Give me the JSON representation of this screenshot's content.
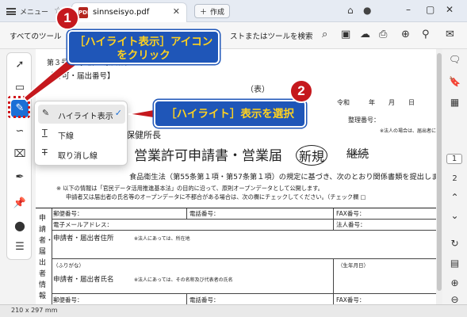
{
  "titlebar": {
    "menu_label": "メニュー",
    "tab_title": "sinnseisyo.pdf",
    "tab_icon_text": "PDF",
    "new_tab_label": "作成"
  },
  "toolbar": {
    "all_tools_label": "すべてのツール",
    "search_placeholder": "ストまたはツールを検索"
  },
  "highlight_menu": {
    "items": [
      {
        "label": "ハイライト表示",
        "icon": "highlighter-icon",
        "selected": true
      },
      {
        "label": "下線",
        "icon": "underline-icon",
        "selected": false
      },
      {
        "label": "取り消し線",
        "icon": "strikethrough-icon",
        "selected": false
      }
    ]
  },
  "document": {
    "form_no": "第３号様式（第４条関係）",
    "form_no_prefix": "第",
    "cut_header": "【許可・届出番号】",
    "omote": "（表）",
    "date_label": "令和",
    "year": "年",
    "month": "月",
    "day": "日",
    "seiri_label": "整理番号：",
    "seiri_note": "※法人の場合は、届出者に記",
    "hoken_text": "保健所長",
    "main_title": "営業許可申請書・営業届",
    "new_label": "新規",
    "continue_label": "継続",
    "law_text": "食品衛生法（第55条第１項・第57条第１項）の規定に基づき、次のとおり関係書類を提出します。",
    "note1": "※ 以下の情報は「官民データ活用推進基本法」の目的に沿って、原則オープンデータとして公開します。",
    "note2": "申請者又は届出者の氏名等のオープンデータに不都合がある場合は、次の欄にチェックしてください。（チェック欄 □",
    "table": {
      "side_label": "申請者・届出者情報",
      "postal": "郵便番号：",
      "phone": "電話番号：",
      "fax": "FAX番号：",
      "email": "電子メールアドレス：",
      "corp_no": "法人番号：",
      "address": "申請者・届出者住所",
      "address_note": "※法人にあっては、所在地",
      "furigana": "（ふりがな）",
      "birth": "（生年月日）",
      "name": "申請者・届出者氏名",
      "name_note": "※法人にあっては、その名称及び代表者の氏名",
      "postal2": "郵便番号：",
      "phone2": "電話番号：",
      "fax2": "FAX番号："
    }
  },
  "right_rail": {
    "page_current": "1",
    "page_next": "2"
  },
  "status": {
    "page_size": "210 x 297 mm"
  },
  "annotations": {
    "step1_number": "1",
    "step1_line1": "［ハイライト表示］アイコン",
    "step1_line2": "をクリック",
    "step2_number": "2",
    "step2_text": "［ハイライト］表示を選択"
  },
  "colors": {
    "accent": "#1b6fd6",
    "callout_bg": "#1f56b8",
    "callout_text": "#ffd21f",
    "badge_red": "#c5181d"
  }
}
